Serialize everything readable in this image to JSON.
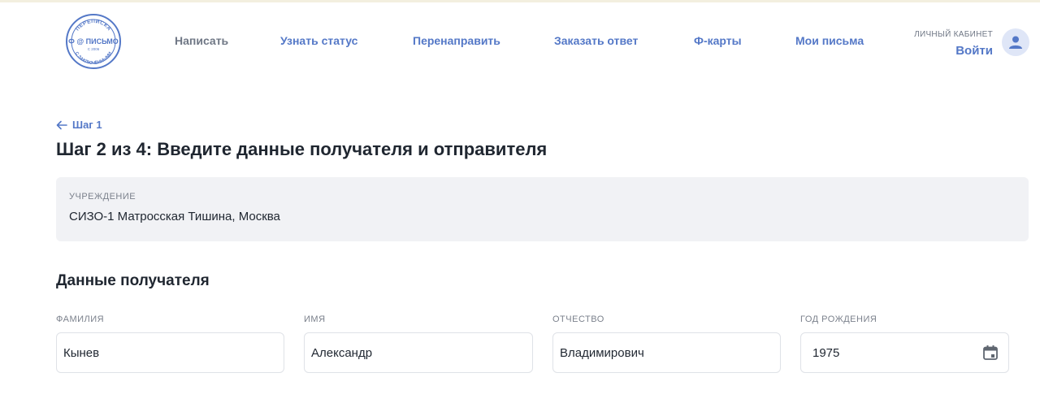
{
  "header": {
    "logo": {
      "text_top": "ПЕРЕПИСКА",
      "text_main": "Ф @ ПИСЬМО",
      "text_since": "С 2006",
      "text_bottom": "С ЗАКЛЮЧЁННЫМИ",
      "color": "#5478c7"
    },
    "nav": [
      {
        "label": "Написать",
        "active": false
      },
      {
        "label": "Узнать статус",
        "active": true
      },
      {
        "label": "Перенаправить",
        "active": true
      },
      {
        "label": "Заказать ответ",
        "active": true
      },
      {
        "label": "Ф-карты",
        "active": true
      },
      {
        "label": "Мои письма",
        "active": true
      }
    ],
    "cabinet_label": "ЛИЧНЫЙ КАБИНЕТ",
    "login_label": "Войти",
    "avatar_icon": "user-icon"
  },
  "main": {
    "back_link": "Шаг 1",
    "title": "Шаг 2 из 4: Введите данные получателя и отправителя",
    "institution": {
      "label": "УЧРЕЖДЕНИЕ",
      "value": "СИЗО-1 Матросская Тишина, Москва"
    },
    "recipient": {
      "section_title": "Данные получателя",
      "fields": [
        {
          "label": "ФАМИЛИЯ",
          "value": "Кынев"
        },
        {
          "label": "ИМЯ",
          "value": "Александр"
        },
        {
          "label": "ОТЧЕСТВО",
          "value": "Владимирович"
        },
        {
          "label": "ГОД РОЖДЕНИЯ",
          "value": "1975",
          "icon": "calendar-icon"
        }
      ]
    }
  },
  "colors": {
    "accent": "#5478c7",
    "muted": "#6f7785",
    "panel": "#f1f2f5",
    "text": "#1f2630"
  }
}
